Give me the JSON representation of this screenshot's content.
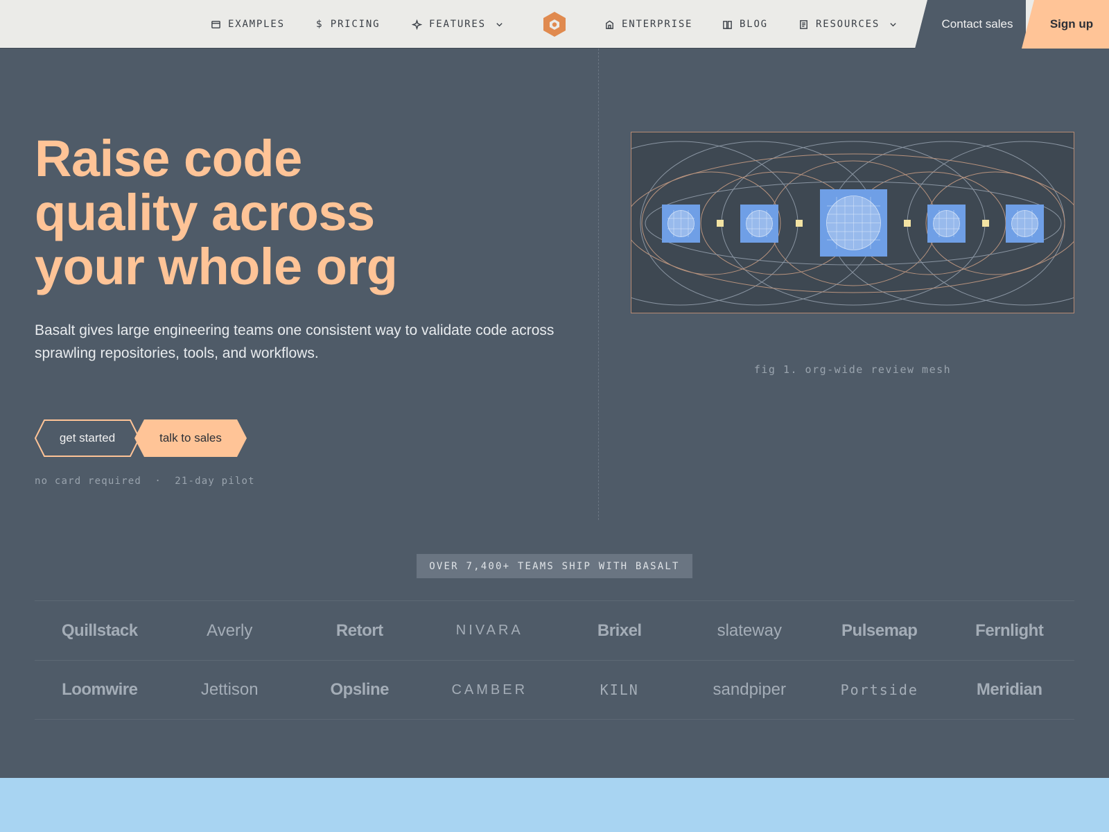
{
  "nav": {
    "items_left": [
      {
        "label": "EXAMPLES",
        "icon": "window-icon"
      },
      {
        "label": "PRICING",
        "icon": "dollar-icon"
      },
      {
        "label": "FEATURES",
        "icon": "sparkle-icon",
        "dropdown": true
      }
    ],
    "items_right": [
      {
        "label": "ENTERPRISE",
        "icon": "building-icon"
      },
      {
        "label": "BLOG",
        "icon": "book-icon"
      },
      {
        "label": "RESOURCES",
        "icon": "document-icon",
        "dropdown": true
      }
    ],
    "logo_icon": "hexagon-logo-icon",
    "contact_label": "Contact sales",
    "signup_label": "Sign up"
  },
  "hero": {
    "title_lines": [
      "Raise code",
      "quality across",
      "your whole org"
    ],
    "subtitle": "Basalt gives large engineering teams one consistent way to validate code across sprawling repositories, tools, and workflows.",
    "primary_cta": "get started",
    "secondary_cta": "talk to sales",
    "note": "no card required  ·  21-day pilot"
  },
  "figure": {
    "caption": "fig 1. org-wide review mesh"
  },
  "trust": {
    "badge": "OVER 7,400+ TEAMS SHIP WITH BASALT",
    "rows": [
      [
        {
          "name": "Quillstack",
          "style": "bold"
        },
        {
          "name": "Averly",
          "style": "light"
        },
        {
          "name": "Retort",
          "style": "bold"
        },
        {
          "name": "NIVARA",
          "style": "caps"
        },
        {
          "name": "Brixel",
          "style": "bold"
        },
        {
          "name": "slateway",
          "style": "light"
        },
        {
          "name": "Pulsemap",
          "style": "bold"
        },
        {
          "name": "Fernlight",
          "style": "bold"
        }
      ],
      [
        {
          "name": "Loomwire",
          "style": "bold"
        },
        {
          "name": "Jettison",
          "style": "light"
        },
        {
          "name": "Opsline",
          "style": "bold"
        },
        {
          "name": "CAMBER",
          "style": "caps"
        },
        {
          "name": "KILN",
          "style": "mono"
        },
        {
          "name": "sandpiper",
          "style": "light"
        },
        {
          "name": "Portside",
          "style": "mono"
        },
        {
          "name": "Meridian",
          "style": "bold"
        }
      ]
    ]
  },
  "colors": {
    "background": "#4f5b68",
    "nav": "#ebebe8",
    "accent": "#ffc497",
    "logo": "#e08a4f",
    "figure_tile": "#6f9fe6",
    "band": "#a8d4f2"
  }
}
